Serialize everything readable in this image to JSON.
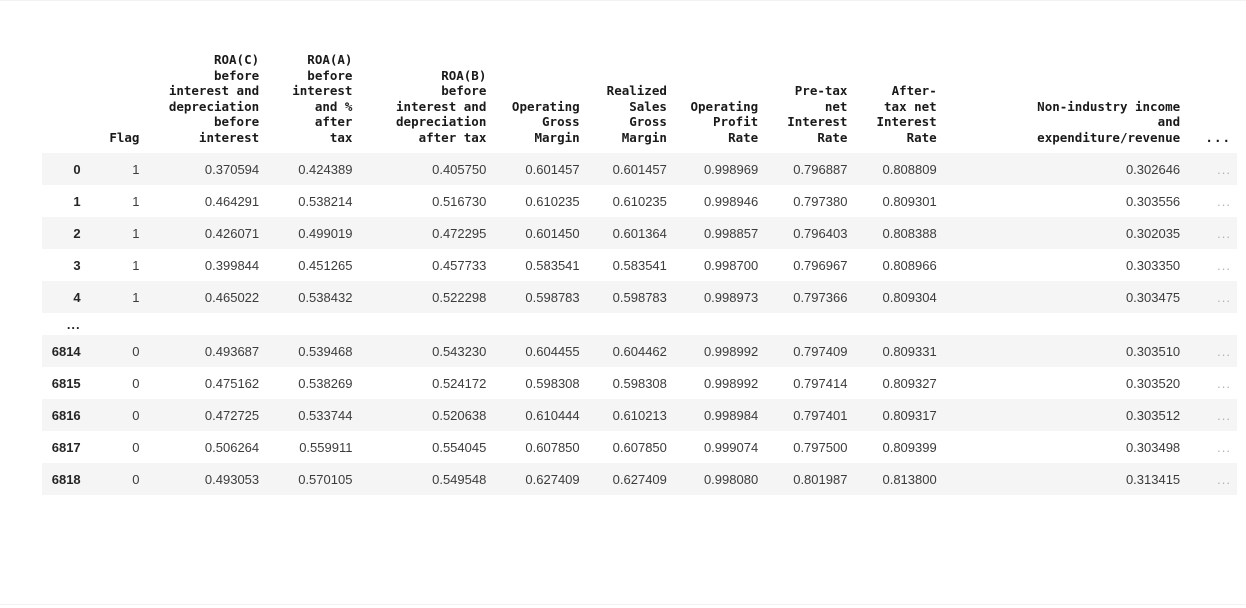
{
  "table": {
    "index_header": "",
    "columns": [
      "Flag",
      "ROA(C)\nbefore\ninterest and\ndepreciation\nbefore\ninterest",
      "ROA(A)\nbefore\ninterest\nand %\nafter\ntax",
      "ROA(B)\nbefore\ninterest and\ndepreciation\nafter tax",
      "Operating\nGross\nMargin",
      "Realized\nSales\nGross\nMargin",
      "Operating\nProfit\nRate",
      "Pre-tax\nnet\nInterest\nRate",
      "After-\ntax net\nInterest\nRate",
      "Non-industry income\nand\nexpenditure/revenue",
      "..."
    ],
    "truncation_marker": "...",
    "row_gap_marker": "...",
    "rows": [
      {
        "index": "0",
        "cells": [
          "1",
          "0.370594",
          "0.424389",
          "0.405750",
          "0.601457",
          "0.601457",
          "0.998969",
          "0.796887",
          "0.808809",
          "0.302646",
          "..."
        ]
      },
      {
        "index": "1",
        "cells": [
          "1",
          "0.464291",
          "0.538214",
          "0.516730",
          "0.610235",
          "0.610235",
          "0.998946",
          "0.797380",
          "0.809301",
          "0.303556",
          "..."
        ]
      },
      {
        "index": "2",
        "cells": [
          "1",
          "0.426071",
          "0.499019",
          "0.472295",
          "0.601450",
          "0.601364",
          "0.998857",
          "0.796403",
          "0.808388",
          "0.302035",
          "..."
        ]
      },
      {
        "index": "3",
        "cells": [
          "1",
          "0.399844",
          "0.451265",
          "0.457733",
          "0.583541",
          "0.583541",
          "0.998700",
          "0.796967",
          "0.808966",
          "0.303350",
          "..."
        ]
      },
      {
        "index": "4",
        "cells": [
          "1",
          "0.465022",
          "0.538432",
          "0.522298",
          "0.598783",
          "0.598783",
          "0.998973",
          "0.797366",
          "0.809304",
          "0.303475",
          "..."
        ]
      },
      {
        "index": "6814",
        "cells": [
          "0",
          "0.493687",
          "0.539468",
          "0.543230",
          "0.604455",
          "0.604462",
          "0.998992",
          "0.797409",
          "0.809331",
          "0.303510",
          "..."
        ]
      },
      {
        "index": "6815",
        "cells": [
          "0",
          "0.475162",
          "0.538269",
          "0.524172",
          "0.598308",
          "0.598308",
          "0.998992",
          "0.797414",
          "0.809327",
          "0.303520",
          "..."
        ]
      },
      {
        "index": "6816",
        "cells": [
          "0",
          "0.472725",
          "0.533744",
          "0.520638",
          "0.610444",
          "0.610213",
          "0.998984",
          "0.797401",
          "0.809317",
          "0.303512",
          "..."
        ]
      },
      {
        "index": "6817",
        "cells": [
          "0",
          "0.506264",
          "0.559911",
          "0.554045",
          "0.607850",
          "0.607850",
          "0.999074",
          "0.797500",
          "0.809399",
          "0.303498",
          "..."
        ]
      },
      {
        "index": "6818",
        "cells": [
          "0",
          "0.493053",
          "0.570105",
          "0.549548",
          "0.627409",
          "0.627409",
          "0.998080",
          "0.801987",
          "0.813800",
          "0.313415",
          "..."
        ]
      }
    ]
  },
  "colors": {
    "stripe": "#f5f5f5",
    "text": "#3c3c3c",
    "header_text": "#1a1a1a",
    "rule": "#dddddd",
    "ellipsis": "#b0b0b0"
  }
}
